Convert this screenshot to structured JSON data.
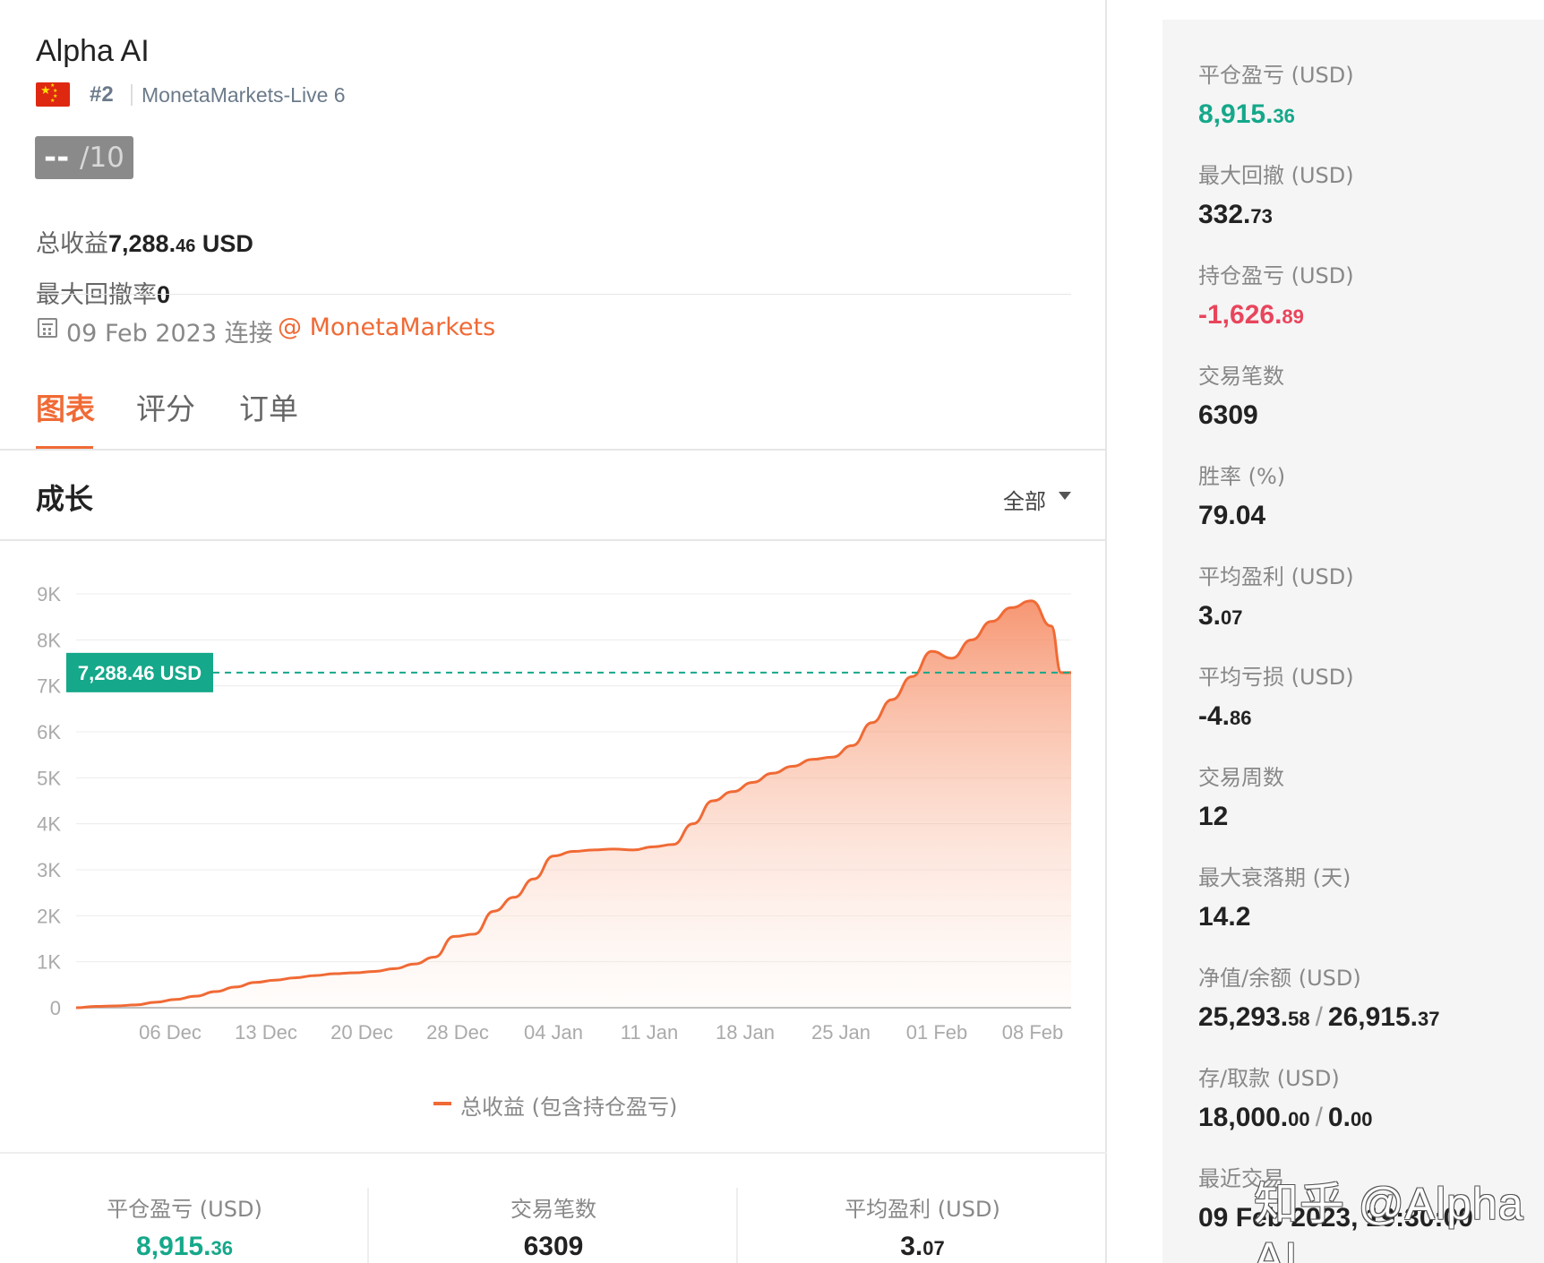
{
  "profile": {
    "name": "Alpha AI",
    "rank": "#2",
    "server": "MonetaMarkets-Live 6",
    "score_main": "--",
    "score_of": "/10",
    "total_profit_label": "总收益",
    "total_profit_int": "7,288.",
    "total_profit_dec": "46",
    "total_profit_unit": " USD",
    "max_dd_rate_label": "最大回撤率",
    "max_dd_rate_value": "0",
    "since": "09 Feb 2023 连接",
    "broker": "@ MonetaMarkets"
  },
  "tabs": [
    {
      "label": "图表",
      "active": true
    },
    {
      "label": "评分",
      "active": false
    },
    {
      "label": "订单",
      "active": false
    }
  ],
  "section": {
    "title": "成长",
    "range": "全部"
  },
  "chart_data": {
    "type": "area",
    "ylabels": [
      "9K",
      "8K",
      "7K",
      "6K",
      "5K",
      "4K",
      "3K",
      "2K",
      "1K",
      "0"
    ],
    "ylim": [
      0,
      9000
    ],
    "xlabels": [
      "06 Dec",
      "13 Dec",
      "20 Dec",
      "28 Dec",
      "04 Jan",
      "11 Jan",
      "18 Jan",
      "25 Jan",
      "01 Feb",
      "08 Feb"
    ],
    "series_name": "总收益 (包含持仓盈亏)",
    "current_label": "7,288.46 USD",
    "current_value": 7288.46,
    "x": [
      0,
      2,
      4,
      6,
      8,
      10,
      12,
      14,
      16,
      18,
      20,
      22,
      24,
      26,
      28,
      30,
      32,
      34,
      36,
      38,
      40,
      42,
      44,
      46,
      48,
      50,
      52,
      54,
      56,
      58,
      60,
      62,
      64,
      66,
      68,
      70,
      72,
      74,
      76,
      78,
      80,
      82,
      84,
      86,
      88,
      90,
      92,
      94,
      96,
      98,
      99,
      100
    ],
    "values": [
      0,
      30,
      40,
      60,
      120,
      180,
      250,
      350,
      450,
      550,
      600,
      650,
      700,
      740,
      760,
      790,
      850,
      950,
      1100,
      1550,
      1600,
      2100,
      2400,
      2800,
      3300,
      3400,
      3430,
      3450,
      3430,
      3500,
      3550,
      4000,
      4500,
      4700,
      4900,
      5100,
      5250,
      5400,
      5450,
      5700,
      6200,
      6700,
      7200,
      7750,
      7600,
      8000,
      8400,
      8700,
      8850,
      8300,
      7288.46,
      7288.46
    ],
    "line_color": "#f06a35",
    "ref_color": "#15a88a"
  },
  "bottom_stats": [
    {
      "label": "平仓盈亏 (USD)",
      "int": "8,915.",
      "dec": "36",
      "color": "green"
    },
    {
      "label": "交易笔数",
      "int": "6309",
      "dec": "",
      "color": "default"
    },
    {
      "label": "平均盈利 (USD)",
      "int": "3.",
      "dec": "07",
      "color": "default"
    }
  ],
  "stats": [
    {
      "label": "平仓盈亏 (USD)",
      "int": "8,915.",
      "dec": "36",
      "color": "green"
    },
    {
      "label": "最大回撤 (USD)",
      "int": "332.",
      "dec": "73",
      "color": "default"
    },
    {
      "label": "持仓盈亏 (USD)",
      "int": "-1,626.",
      "dec": "89",
      "color": "red"
    },
    {
      "label": "交易笔数",
      "int": "6309",
      "dec": "",
      "color": "default"
    },
    {
      "label": "胜率 (%)",
      "int": "79.04",
      "dec": "",
      "color": "default"
    },
    {
      "label": "平均盈利 (USD)",
      "int": "3.",
      "dec": "07",
      "color": "default"
    },
    {
      "label": "平均亏损 (USD)",
      "int": "-4.",
      "dec": "86",
      "color": "default"
    },
    {
      "label": "交易周数",
      "int": "12",
      "dec": "",
      "color": "default"
    },
    {
      "label": "最大衰落期 (天)",
      "int": "14.2",
      "dec": "",
      "color": "default"
    }
  ],
  "equity_balance": {
    "label": "净值/余额 (USD)",
    "a_int": "25,293.",
    "a_dec": "58",
    "b_int": "26,915.",
    "b_dec": "37"
  },
  "deposit_withdraw": {
    "label": "存/取款 (USD)",
    "a_int": "18,000.",
    "a_dec": "00",
    "b_int": "0.",
    "b_dec": "00"
  },
  "last_trade": {
    "label": "最近交易",
    "value": "09 Feb 2023, 19:30:00"
  },
  "watermark": "知乎 @Alpha AI"
}
